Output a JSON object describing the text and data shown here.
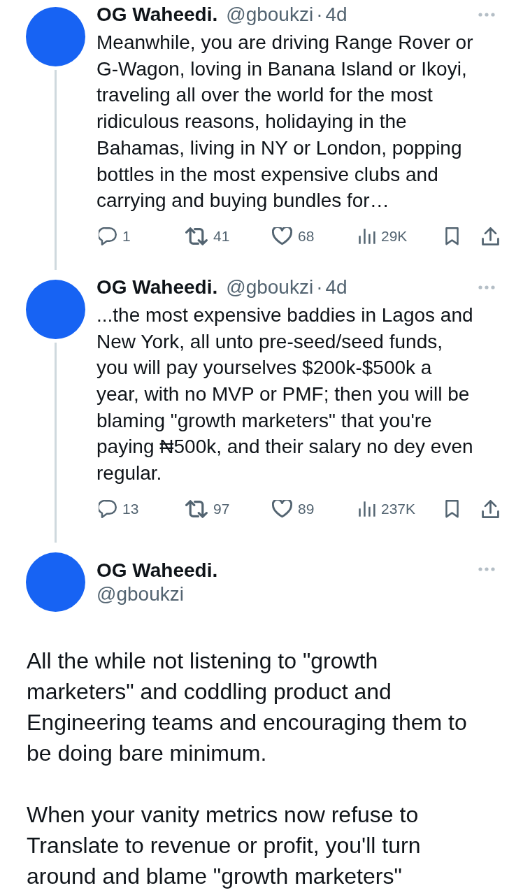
{
  "thread": [
    {
      "name": "OG Waheedi.",
      "handle": "@gboukzi",
      "separator": "·",
      "time": "4d",
      "text": "Meanwhile, you are driving Range Rover or\nG-Wagon, loving in Banana Island or Ikoyi,\ntraveling all over the world for the most\nridiculous reasons, holidaying in the\nBahamas, living in NY or London, popping\nbottles in the most expensive clubs and\ncarrying and buying bundles for…",
      "actions": [
        {
          "kind": "reply",
          "count": "1"
        },
        {
          "kind": "repost",
          "count": "41"
        },
        {
          "kind": "like",
          "count": "68"
        },
        {
          "kind": "views",
          "count": "29K"
        },
        {
          "kind": "bookmark"
        },
        {
          "kind": "share"
        }
      ]
    },
    {
      "name": "OG Waheedi.",
      "handle": "@gboukzi",
      "separator": "·",
      "time": "4d",
      "text": "...the most expensive baddies in Lagos and\nNew York, all unto pre-seed/seed funds,\nyou will pay yourselves $200k-$500k a\nyear, with no MVP or PMF; then you will be\nblaming \"growth marketers\" that you're\npaying ₦500k, and their salary no dey even\nregular.",
      "actions": [
        {
          "kind": "reply",
          "count": "13"
        },
        {
          "kind": "repost",
          "count": "97"
        },
        {
          "kind": "like",
          "count": "89"
        },
        {
          "kind": "views",
          "count": "237K"
        },
        {
          "kind": "bookmark"
        },
        {
          "kind": "share"
        }
      ]
    }
  ],
  "focused_post": {
    "name": "OG Waheedi.",
    "handle": "@gboukzi",
    "paragraphs": [
      "All the while not listening to \"growth\nmarketers\" and coddling product and\nEngineering teams and encouraging them to\nbe doing bare minimum.",
      "When your vanity metrics now refuse to\nTranslate to revenue or profit, you'll turn\naround and blame \"growth marketers\""
    ]
  }
}
